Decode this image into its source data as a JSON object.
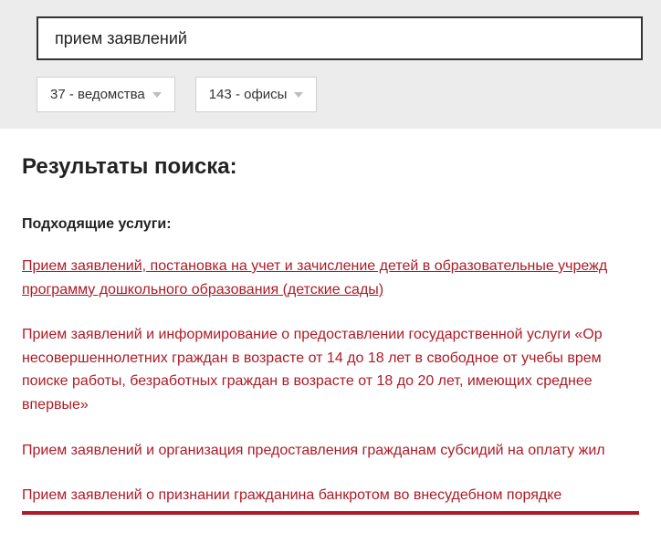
{
  "search": {
    "value": "прием заявлений"
  },
  "filters": {
    "departments": "37 - ведомства",
    "offices": "143 - офисы"
  },
  "results": {
    "title": "Результаты поиска:",
    "subtitle": "Подходящие услуги:",
    "items": [
      "Прием заявлений, постановка на учет и зачисление детей в образовательные учрежд программу дошкольного образования (детские сады)",
      "Прием заявлений и информирование о предоставлении государственной услуги «Ор несовершеннолетних граждан в возрасте от 14 до 18 лет в свободное от учебы врем поиске работы, безработных граждан в возрасте от 18 до 20 лет, имеющих среднее впервые»",
      "Прием заявлений и организация предоставления гражданам субсидий на оплату жил",
      "Прием заявлений о признании гражданина банкротом во внесудебном порядке"
    ]
  }
}
